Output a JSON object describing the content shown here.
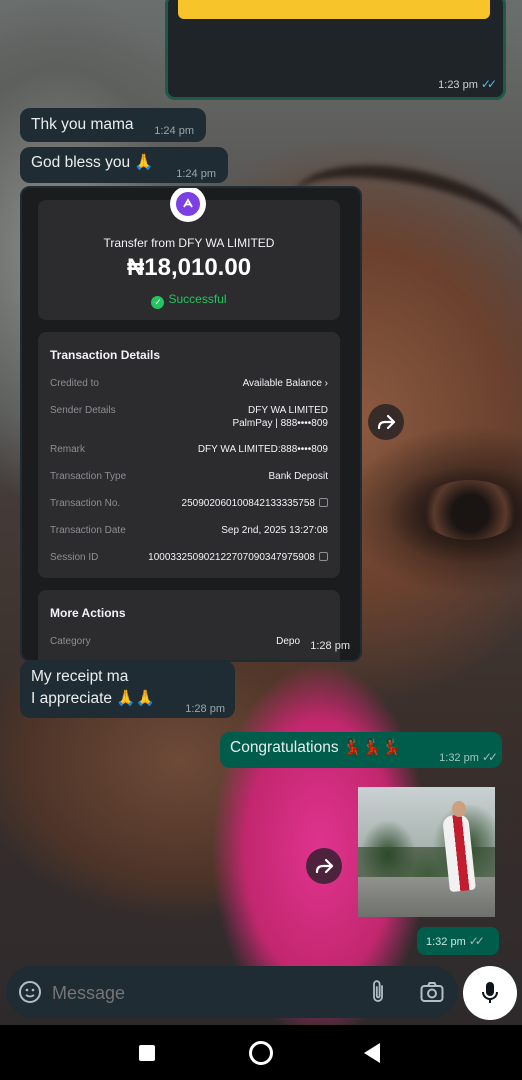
{
  "top_message": {
    "time": "1:23 pm"
  },
  "messages": [
    {
      "text": "Thk you mama",
      "time": "1:24 pm"
    },
    {
      "text": "God bless you 🙏",
      "time": "1:24 pm"
    }
  ],
  "receipt": {
    "title": "Transfer from DFY WA LIMITED",
    "amount": "₦18,010.00",
    "status": "Successful",
    "details_header": "Transaction Details",
    "rows": [
      {
        "label": "Credited to",
        "value": "Available Balance  ›"
      },
      {
        "label": "Sender Details",
        "value": "DFY WA LIMITED",
        "value2": "PalmPay | 888••••809"
      },
      {
        "label": "Remark",
        "value": "DFY WA LIMITED:888••••809"
      },
      {
        "label": "Transaction Type",
        "value": "Bank Deposit"
      },
      {
        "label": "Transaction No.",
        "value": "250902060100842133335758"
      },
      {
        "label": "Transaction Date",
        "value": "Sep 2nd, 2025 13:27:08"
      },
      {
        "label": "Session ID",
        "value": "100033250902122707090347975908"
      }
    ],
    "more_actions": "More Actions",
    "category_label": "Category",
    "category_value": "Depo",
    "time": "1:28 pm"
  },
  "receipt_reply": {
    "line1": "My receipt ma",
    "line2": "I appreciate 🙏🙏",
    "time": "1:28 pm"
  },
  "congrats": {
    "text": "Congratulations 💃🏾💃🏾💃🏾",
    "time": "1:32 pm"
  },
  "image_message": {
    "time": "1:32 pm"
  },
  "composer": {
    "placeholder": "Message"
  },
  "colors": {
    "incoming": "#202c33",
    "outgoing": "#005c4b",
    "accent_green": "#22c55e",
    "read_ticks": "#53bdeb"
  }
}
